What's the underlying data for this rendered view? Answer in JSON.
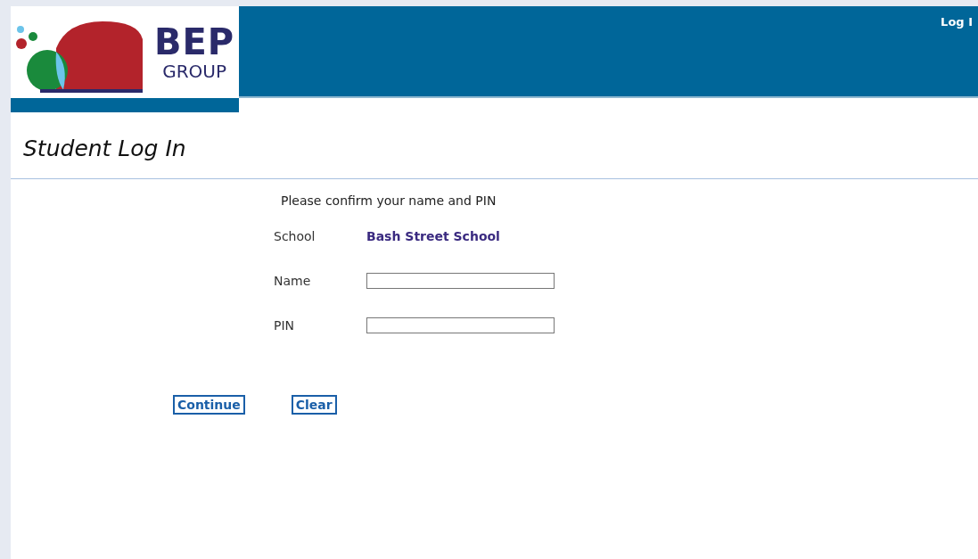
{
  "logo": {
    "name": "BEP",
    "subtitle": "GROUP"
  },
  "header": {
    "link": "Log I"
  },
  "page_title": "Student Log In",
  "form": {
    "instruction": "Please confirm your name and PIN",
    "fields": [
      {
        "kind": "text",
        "label": "School",
        "value": "Bash Street School"
      },
      {
        "kind": "input",
        "label": "Name"
      },
      {
        "kind": "input",
        "label": "PIN"
      }
    ]
  },
  "buttons": [
    "Continue",
    "Clear"
  ]
}
